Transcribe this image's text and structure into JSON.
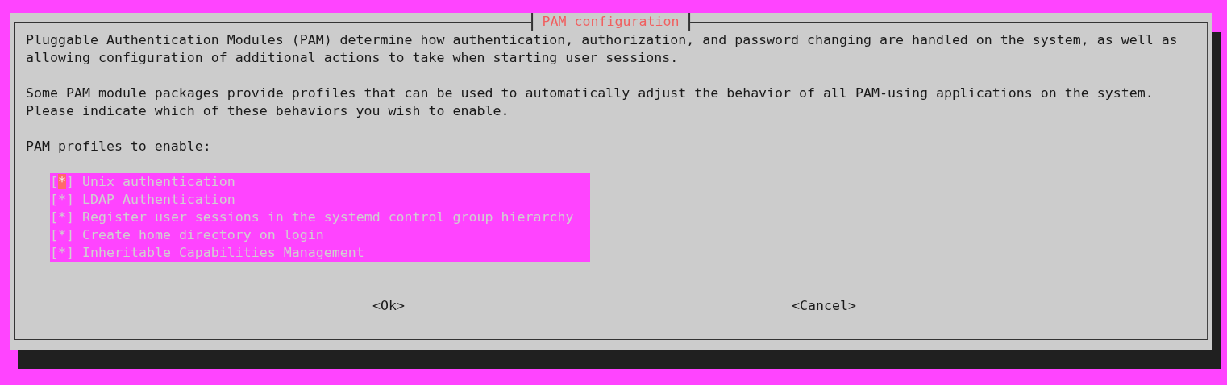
{
  "dialog": {
    "title": "PAM configuration",
    "paragraphs": [
      "Pluggable Authentication Modules (PAM) determine how authentication, authorization, and password changing are handled on the system, as well as allowing configuration of additional actions to take when starting user sessions.",
      "Some PAM module packages provide profiles that can be used to automatically adjust the behavior of all PAM-using applications on the system. Please indicate which of these behaviors you wish to enable."
    ],
    "prompt": "PAM profiles to enable:",
    "profiles": [
      {
        "checkbox": "[*]",
        "label": "Unix authentication",
        "checked": true,
        "selected": true
      },
      {
        "checkbox": "[*]",
        "label": "LDAP Authentication",
        "checked": true,
        "selected": false
      },
      {
        "checkbox": "[*]",
        "label": "Register user sessions in the systemd control group hierarchy",
        "checked": true,
        "selected": false
      },
      {
        "checkbox": "[*]",
        "label": "Create home directory on login",
        "checked": true,
        "selected": false
      },
      {
        "checkbox": "[*]",
        "label": "Inheritable Capabilities Management",
        "checked": true,
        "selected": false
      }
    ],
    "buttons": [
      {
        "label": "<Ok>"
      },
      {
        "label": "<Cancel>"
      }
    ]
  }
}
